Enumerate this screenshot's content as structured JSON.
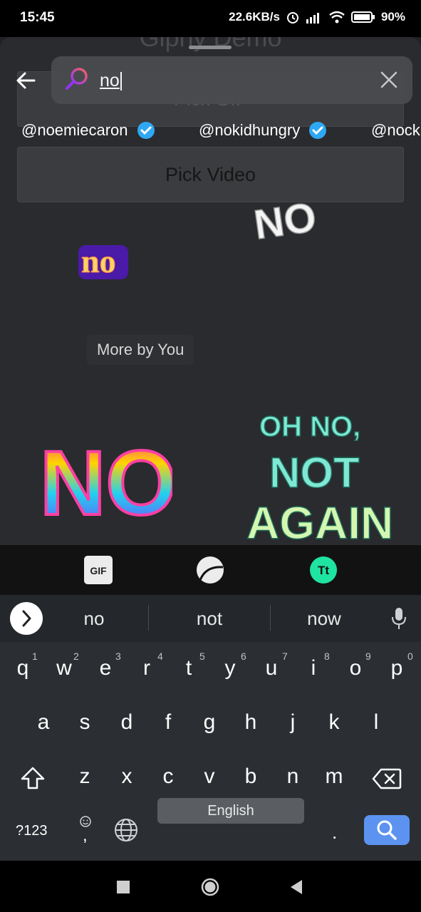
{
  "status_bar": {
    "time": "15:45",
    "network_speed": "22.6KB/s",
    "battery": "90"
  },
  "app": {
    "title": "Giphy Demo",
    "pick_gif_label": "Pick GIF",
    "pick_video_label": "Pick Video"
  },
  "search": {
    "query": "no",
    "back_icon": "arrow-left-icon",
    "clear_icon": "close-icon"
  },
  "channels": [
    {
      "handle": "@noemiecaron",
      "verified": true
    },
    {
      "handle": "@nokidhungry",
      "verified": true
    },
    {
      "handle": "@nock",
      "verified": false
    }
  ],
  "stickers": {
    "sticker_1_text": "NO",
    "sticker_2_text": "no",
    "more_by_you_label": "More by You",
    "sticker_3_text": "NO",
    "sticker_4_text": "OH NO, NOT AGAIN!"
  },
  "type_bar": {
    "gif_label": "GIF",
    "sticker_icon": "sticker-icon",
    "text_label": "Tt"
  },
  "keyboard": {
    "suggestions": [
      "no",
      "not",
      "now"
    ],
    "row1": [
      "q",
      "w",
      "e",
      "r",
      "t",
      "y",
      "u",
      "i",
      "o",
      "p"
    ],
    "row1_numbers": [
      "1",
      "2",
      "3",
      "4",
      "5",
      "6",
      "7",
      "8",
      "9",
      "0"
    ],
    "row2": [
      "a",
      "s",
      "d",
      "f",
      "g",
      "h",
      "j",
      "k",
      "l"
    ],
    "row3": [
      "z",
      "x",
      "c",
      "v",
      "b",
      "n",
      "m"
    ],
    "symbols_label": "?123",
    "comma_label": ",",
    "space_label": "English",
    "period_label": "."
  },
  "colors": {
    "accent_blue": "#5c93f0",
    "verified_blue": "#2ea8f2",
    "text_tt_green": "#1fe3a0"
  }
}
